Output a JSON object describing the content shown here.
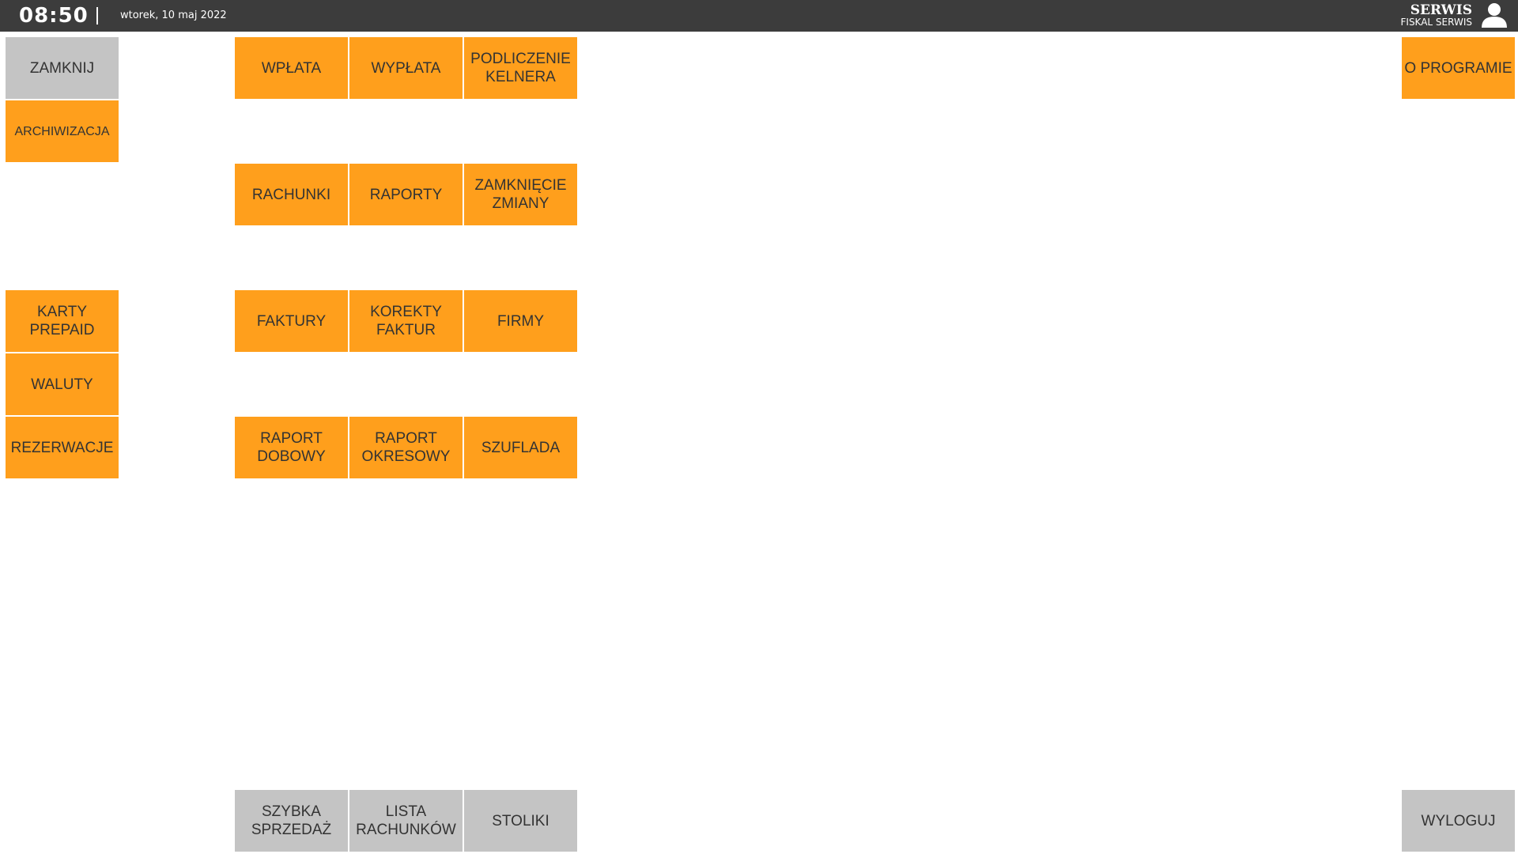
{
  "header": {
    "time": "08:50",
    "date": "wtorek, 10 maj 2022",
    "user_name": "SERWIS",
    "user_subtitle": "FISKAL SERWIS",
    "avatar_icon": "user-icon"
  },
  "colors": {
    "topbar": "#3c3c3c",
    "tile_orange": "#ff9f1c",
    "tile_gray": "#c4c4c4",
    "tile_text": "#333333"
  },
  "buttons": {
    "zamknij": "ZAMKNIJ",
    "archiwizacja": "ARCHIWIZACJA",
    "karty_prepaid": "KARTY PREPAID",
    "waluty": "WALUTY",
    "rezerwacje": "REZERWACJE",
    "wplata": "WPŁATA",
    "wyplata": "WYPŁATA",
    "podliczenie_kelnera": "PODLICZENIE\nKELNERA",
    "rachunki": "RACHUNKI",
    "raporty": "RAPORTY",
    "zamkniecie_zmiany": "ZAMKNIĘCIE\nZMIANY",
    "faktury": "FAKTURY",
    "korekty_faktur": "KOREKTY\nFAKTUR",
    "firmy": "FIRMY",
    "raport_dobowy": "RAPORT\nDOBOWY",
    "raport_okresowy": "RAPORT\nOKRESOWY",
    "szuflada": "SZUFLADA",
    "szybka_sprzedaz": "SZYBKA\nSPRZEDAŻ",
    "lista_rachunkow": "LISTA\nRACHUNKÓW",
    "stoliki": "STOLIKI",
    "o_programie": "O PROGRAMIE",
    "wyloguj": "WYLOGUJ"
  }
}
